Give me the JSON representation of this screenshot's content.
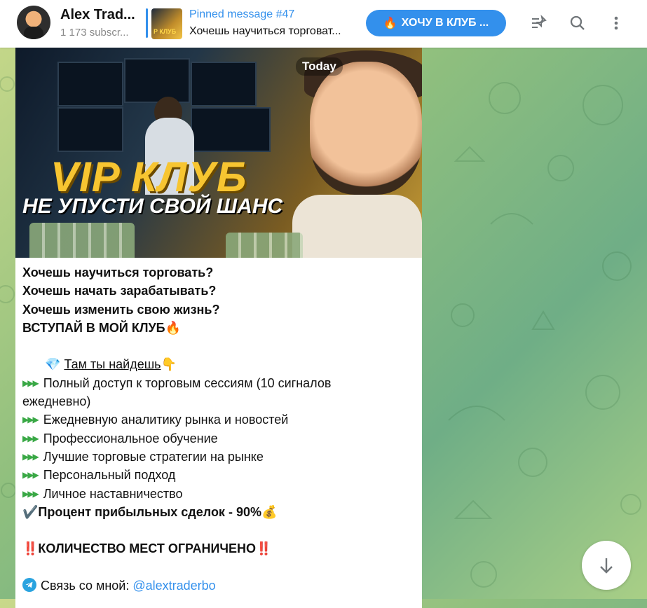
{
  "header": {
    "channel_title": "Alex Trad...",
    "subscribers": "1 173 subscr...",
    "pinned_label": "Pinned message #47",
    "pinned_text": "Хочешь научиться торговат...",
    "pinned_thumb_text": "P КЛУБ",
    "club_button_emoji": "🔥",
    "club_button_label": "ХОЧУ В КЛУБ ...",
    "icons": [
      "pin-list-icon",
      "search-icon",
      "more-icon"
    ]
  },
  "message": {
    "date_badge": "Today",
    "image_title": "VIP КЛУБ",
    "image_subtitle": "НЕ УПУСТИ СВОЙ ШАНС",
    "lines": {
      "q1": "Хочешь научиться торговать?",
      "q2": "Хочешь начать зарабатывать?",
      "q3": "Хочешь изменить свою жизнь?",
      "join": "ВСТУПАЙ В МОЙ КЛУБ",
      "join_emoji": "🔥",
      "find_emoji": "💎",
      "find": "Там ты найдешь",
      "find_emoji2": "👇",
      "bullet_marker": "▶▶▶",
      "b1": "Полный доступ к торговым сессиям (10 сигналов",
      "b1b": "ежедневно)",
      "b2": "Ежедневную аналитику рынка и новостей",
      "b3": "Профессиональное обучение",
      "b4": "Лучшие торговые стратегии на рынке",
      "b5": "Персональный подход",
      "b6": "Личное наставничество",
      "check_emoji": "✔️",
      "profit": "Процент прибыльных сделок - 90%",
      "profit_emoji": "💰",
      "warn_emoji": "‼️",
      "limited": "КОЛИЧЕСТВО МЕСТ ОГРАНИЧЕНО",
      "contact_label": "Связь со мной:",
      "contact_link": "@alextraderbo"
    }
  },
  "colors": {
    "accent": "#3390ec",
    "bullet": "#39a845"
  }
}
